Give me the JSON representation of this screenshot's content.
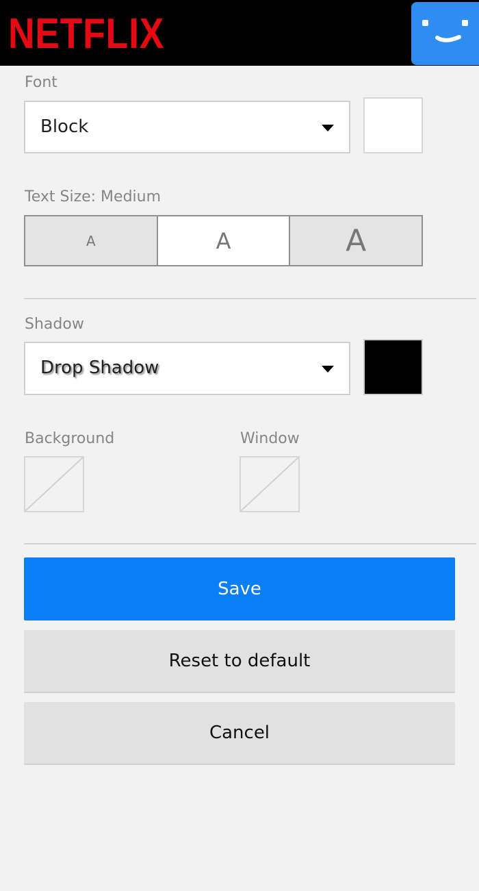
{
  "header": {
    "logo_text": "NETFLIX",
    "avatar_icon": "smiley-profile-icon",
    "logo_color": "#e50914",
    "avatar_color": "#2f8cf0"
  },
  "font": {
    "label": "Font",
    "selected": "Block",
    "color_swatch": "#ffffff"
  },
  "text_size": {
    "label": "Text Size: Medium",
    "options": [
      "A",
      "A",
      "A"
    ],
    "selected_index": 1
  },
  "shadow": {
    "label": "Shadow",
    "selected": "Drop Shadow",
    "color_swatch": "#000000"
  },
  "background": {
    "label": "Background",
    "swatch_icon": "none-slash-icon"
  },
  "window": {
    "label": "Window",
    "swatch_icon": "none-slash-icon"
  },
  "buttons": {
    "save": "Save",
    "reset": "Reset to default",
    "cancel": "Cancel"
  },
  "colors": {
    "accent": "#0a7ff5"
  }
}
